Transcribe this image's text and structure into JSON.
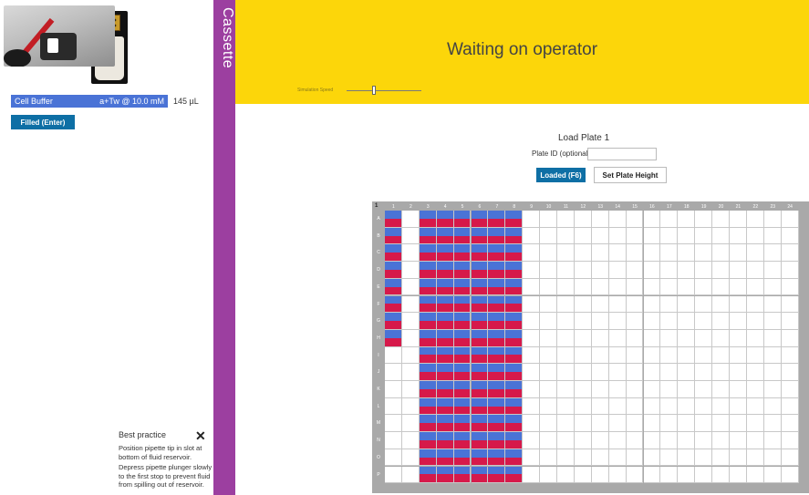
{
  "cassette_panel": {
    "reagent": {
      "name": "Cell Buffer",
      "detail": "a+Tw @ 10.0 mM",
      "volume": "145 µL"
    },
    "filled_button": "Filled  (Enter)"
  },
  "best_practice": {
    "title": "Best practice",
    "close_icon": "close-icon",
    "paragraphs": [
      "Position pipette tip in slot at bottom of fluid reservoir.",
      "Depress pipette plunger slowly to the first stop to prevent fluid from spilling out of reservoir."
    ]
  },
  "cassette_band": {
    "label": "Cassette"
  },
  "banner": {
    "title": "Waiting on operator",
    "speed_label": "Simulation Speed"
  },
  "load_plate": {
    "title": "Load Plate 1",
    "plate_id_label": "Plate ID (optional)",
    "plate_id_value": "",
    "loaded_button": "Loaded  (F6)",
    "height_button": "Set Plate Height"
  },
  "plate": {
    "corner_label": "1",
    "columns": [
      "1",
      "2",
      "3",
      "4",
      "5",
      "6",
      "7",
      "8",
      "9",
      "10",
      "11",
      "12",
      "13",
      "14",
      "15",
      "16",
      "17",
      "18",
      "19",
      "20",
      "21",
      "22",
      "23",
      "24"
    ],
    "rows": [
      "A",
      "B",
      "C",
      "D",
      "E",
      "F",
      "G",
      "H",
      "I",
      "J",
      "K",
      "L",
      "M",
      "N",
      "O",
      "P"
    ],
    "filled_columns": [
      "1",
      "3",
      "4",
      "5",
      "6",
      "7",
      "8"
    ],
    "column_1_filled_rows": [
      "A",
      "B",
      "C",
      "D",
      "E",
      "F",
      "G",
      "H"
    ],
    "fill_colors": {
      "top": "#4a73d6",
      "bottom": "#d6194a"
    }
  },
  "colors": {
    "banner": "#fcd60a",
    "cassette_band": "#9c3fa0",
    "primary_button": "#0e6fa5",
    "plate_frame": "#a9a9a9"
  }
}
